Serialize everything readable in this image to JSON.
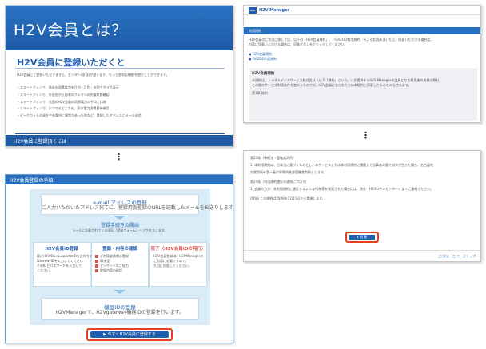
{
  "panel_a": {
    "hero_title": "H2V会員とは？",
    "section_title": "H2V会員に登録いただくと",
    "intro": "H2V会員にご登録いただきますと、センター(家庭)が遠くなり、もっと便利な機能を使うことができます。",
    "bullets": [
      "・スマートフォンで、過去の消費電力を日別・月別・年別でグラフ表示",
      "・スマートフォンで、外出先から自宅のクルマへの充電状態確認",
      "・スマートフォンで、全国のH2V会員の消費電力の平均と比較",
      "・スマートフォンで、いつでもどこでも、家の電力消費量を確認",
      "・ピークカットの発生や充電中に異常があった時など、登録したアドレスにメール送信"
    ],
    "footer_bar": "H2V会員に登録頂くには"
  },
  "panel_b": {
    "header": "H2V会員登録の手順",
    "step1_title": "e-mail アドレスの登録",
    "step1_text": "ご入力いただいたアドレス宛てに、登録用仮登録のURLを記載したメールをお送りします。",
    "step2_title": "登録手続きの開始",
    "step2_text": "メールに記載されているURL（登録フォーム）へアクセスします。",
    "col1_title": "H2V会員ID登録",
    "col1_text": [
      "既にH2V/OneSupportのIDをお持ちの方は",
      "GatewayIDを入力してください",
      "そのIDとパスワードを入力して",
      "ください。"
    ],
    "col2_title": "登録・内容の確認",
    "col2_items": [
      "ご利用者情報の登録",
      "ID決定",
      "アンケートのご協力",
      "登録内容の確認"
    ],
    "col3_title": "完了（H2V会員IDの発行）",
    "col3_text": [
      "H2V会員登録は、H2VManagerの",
      "ご利用に必要ですので、",
      "大切に保管してください。"
    ],
    "step3_title": "機器IDの登録",
    "step3_text": "H2VManagerで、H2Vgateway機器IDの登録を行います。",
    "cta_label": "▶ 今すぐH2V会員に登録する"
  },
  "panel_c": {
    "logo": "H2V",
    "brand": "H2V Manager",
    "bar_title": "利用規約",
    "body": [
      "H2V会員のご利用に際しては、以下の「H2V会員規約」、「GAZOO利用規約」をよくお読み頂いた上、同意いただける場合は、",
      "内容に同意いただける場合は、同意ボタンをクリックしてください。"
    ],
    "links": [
      "● H2V会員規約",
      "● GAZOO利用規約"
    ],
    "terms_title": "H2V会員規約",
    "terms_body": [
      "本規約は、トヨタメディアサービス株式会社（以下「弊社」という。）が提供するH2V Managerの会員となる利用者の皆様と弊社",
      "との間のサービス利用条件を定めるものです。H2V会員になられた方は本規約に同意したものとみなされます。",
      "第1章 総則"
    ]
  },
  "panel_d": {
    "body": [
      "第23条（準拠法・管轄裁判所）",
      "1. 本利用規約は、日本法に基づくものとし、本サービスまたは本利用規約に関連して当事者の間で紛争が生じた場合、名古屋地",
      "方裁判所を第一審の専属的合意管轄裁判所とします。",
      "第24条（利用規約違反の通知について）",
      "1. 会員の方が、本利用規約に違反するような行為等を発見された場合には、弊社「H2Vコールセンター」までご連絡ください。",
      "(附則) この規約は2009年11月1日から実施します。"
    ],
    "agree_label": "▸ 同 意",
    "footer_links": "□ 戻る　□ ページトップ"
  },
  "separators": [
    "⋮",
    "⋮"
  ]
}
